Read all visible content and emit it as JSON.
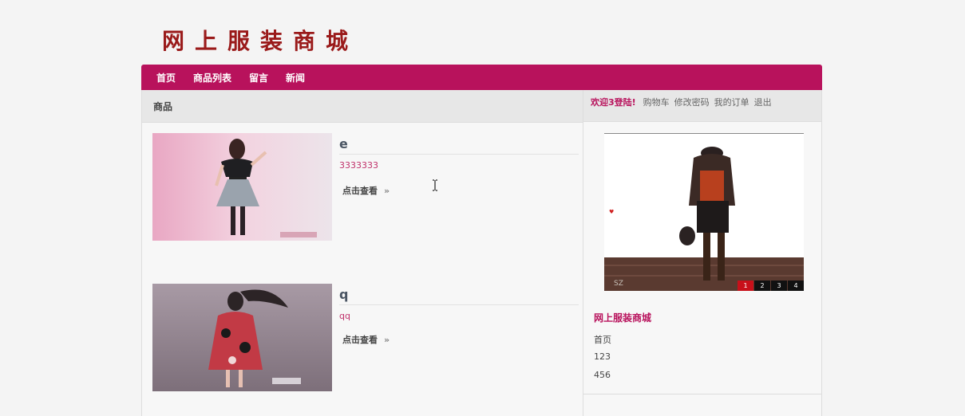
{
  "site_title": "网上服装商城",
  "nav": [
    "首页",
    "商品列表",
    "留言",
    "新闻"
  ],
  "main": {
    "header": "商品",
    "products": [
      {
        "name": "e",
        "description": "3333333",
        "link": "点击查看",
        "arrow": "»"
      },
      {
        "name": "q",
        "description": "qq",
        "link": "点击查看",
        "arrow": "»"
      }
    ]
  },
  "sidebar": {
    "welcome": "欢迎3登陆!",
    "links": [
      "购物车",
      "修改密码",
      "我的订单",
      "退出"
    ],
    "slider": {
      "pages": [
        "1",
        "2",
        "3",
        "4"
      ],
      "active": 0
    },
    "section_title": "网上服装商城",
    "items": [
      "首页",
      "123",
      "456"
    ]
  }
}
